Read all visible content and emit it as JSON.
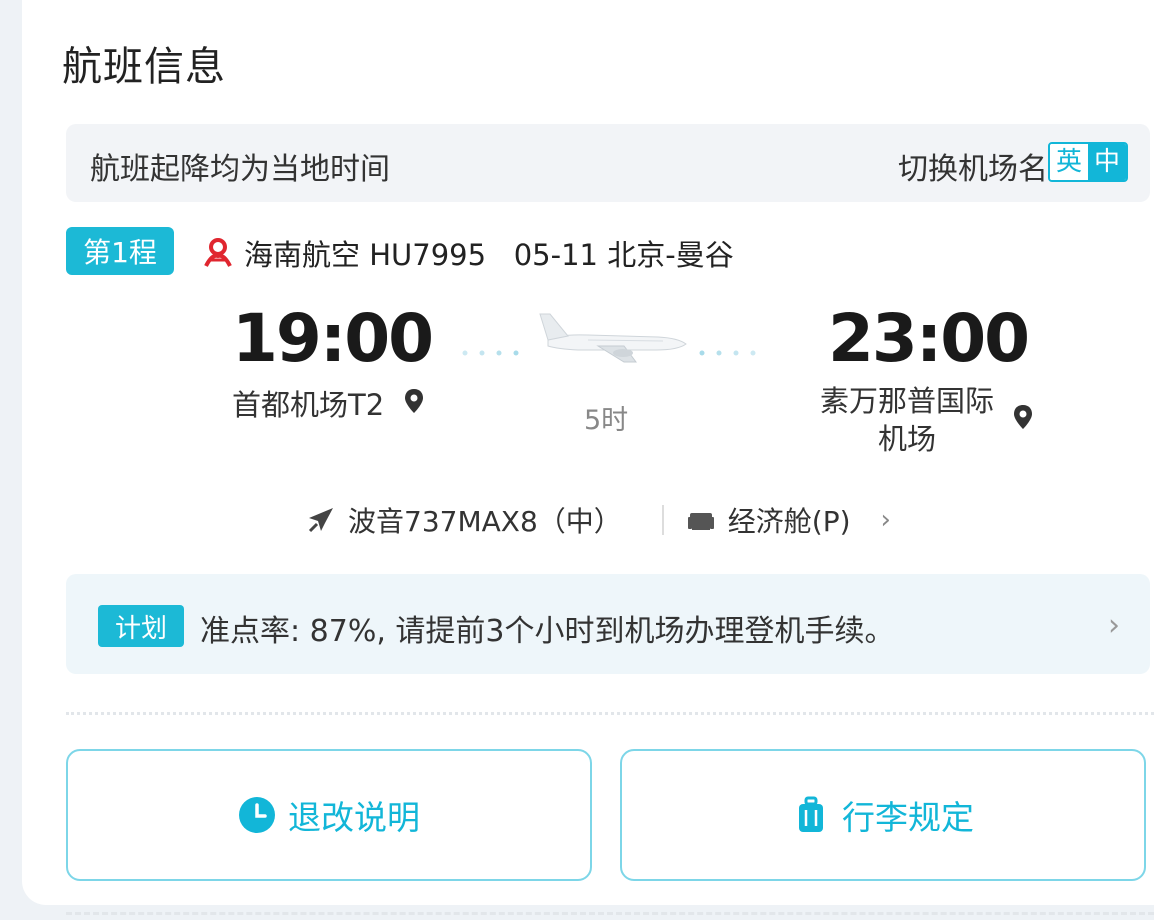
{
  "section": {
    "title": "航班信息"
  },
  "notice": {
    "text": "航班起降均为当地时间",
    "switch_label": "切换机场名",
    "lang_options": [
      "英",
      "中"
    ],
    "selected": "中"
  },
  "segment": {
    "badge": "第1程",
    "airline_logo": "hainan-airlines-logo",
    "airline": "海南航空",
    "flight_no": "HU7995",
    "date": "05-11",
    "route": "北京-曼谷"
  },
  "departure": {
    "time": "19:00",
    "airport": "首都机场T2"
  },
  "arrival": {
    "time": "23:00",
    "airport": "素万那普国际机场"
  },
  "duration": "5时",
  "aircraft": {
    "model": "波音737MAX8（中）",
    "cabin": "经济舱(P)"
  },
  "ontime": {
    "badge": "计划",
    "text": "准点率: 87%, 请提前3个小时到机场办理登机手续。"
  },
  "buttons": {
    "refund": "退改说明",
    "baggage": "行李规定"
  },
  "colors": {
    "accent": "#12b6d8",
    "badge": "#1cb9d6",
    "brand_red": "#e0262f"
  }
}
